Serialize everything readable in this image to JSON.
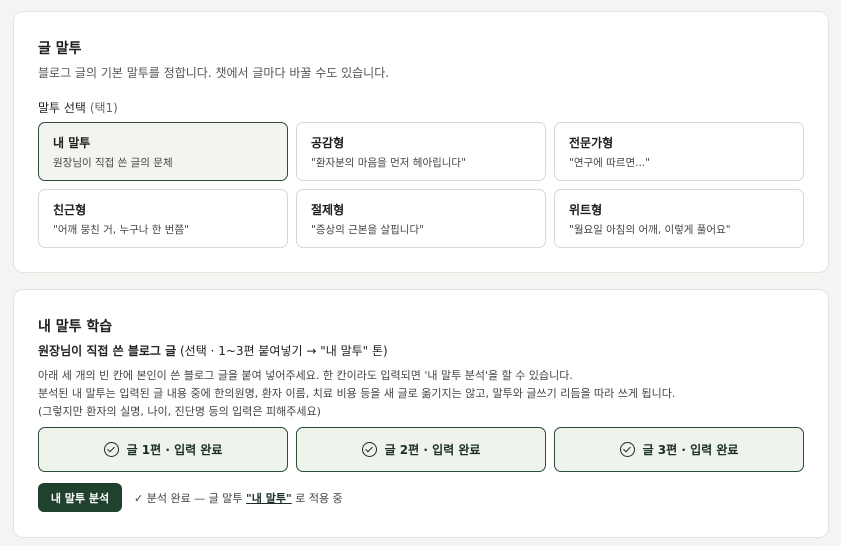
{
  "tone_card": {
    "title": "글 말투",
    "description": "블로그 글의 기본 말투를 정합니다. 챗에서 글마다 바꿀 수도 있습니다.",
    "select_label": "말투 선택",
    "select_hint": "(택1)",
    "options": [
      {
        "name": "내 말투",
        "sub": "원장님이 직접 쓴 글의 문체",
        "selected": true
      },
      {
        "name": "공감형",
        "sub": "\"환자분의 마음을 먼저 헤아립니다\"",
        "selected": false
      },
      {
        "name": "전문가형",
        "sub": "\"연구에 따르면...\"",
        "selected": false
      },
      {
        "name": "친근형",
        "sub": "\"어깨 뭉친 거, 누구나 한 번쯤\"",
        "selected": false
      },
      {
        "name": "절제형",
        "sub": "\"증상의 근본을 살핍니다\"",
        "selected": false
      },
      {
        "name": "위트형",
        "sub": "\"월요일 아침의 어깨, 이렇게 풀어요\"",
        "selected": false
      }
    ]
  },
  "learn_card": {
    "title": "내 말투 학습",
    "subtitle_bold": "원장님이 직접 쓴 블로그 글",
    "subtitle_rest": "(선택 · 1~3편 붙여넣기 → \"내 말투\" 톤)",
    "lines": [
      "아래 세 개의 빈 칸에 본인이 쓴 블로그 글을 붙여 넣어주세요. 한 칸이라도 입력되면 '내 말투 분석'을 할 수 있습니다.",
      "분석된 내 말투는 입력된 글 내용 중에 한의원명, 환자 이름, 치료 비용 등을 새 글로 옮기지는 않고, 말투와 글쓰기 리듬을 따라 쓰게 됩니다.",
      "(그렇지만 환자의 실명, 나이, 진단명 등의 입력은 피해주세요)"
    ],
    "posts": [
      {
        "label": "글 1편 · 입력 완료"
      },
      {
        "label": "글 2편 · 입력 완료"
      },
      {
        "label": "글 3편 · 입력 완료"
      }
    ],
    "analyze_button": "내 말투 분석",
    "status_prefix": "✓ 분석 완료 — 글 말투",
    "status_tone": "\"내 말투\"",
    "status_suffix": "로 적용 중"
  },
  "colors": {
    "accent": "#21412f",
    "selected_bg": "#f2f5ef",
    "page_bg": "#f4f4f2"
  }
}
